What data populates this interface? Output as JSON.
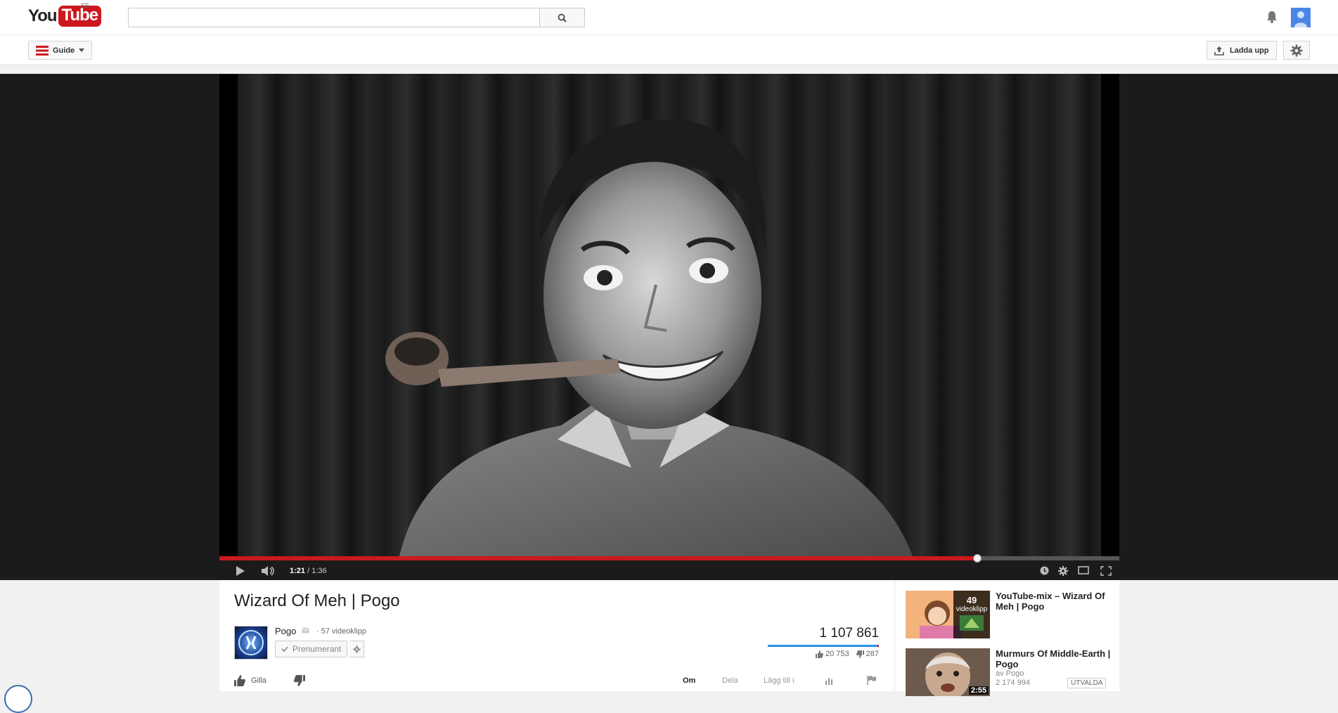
{
  "header": {
    "logo_you": "You",
    "logo_tube": "Tube",
    "country": "SE",
    "search_value": "",
    "search_placeholder": ""
  },
  "subbar": {
    "guide_label": "Guide",
    "upload_label": "Ladda upp"
  },
  "player": {
    "time_current": "1:21",
    "time_total": "/ 1:36",
    "progress": 0.842
  },
  "video": {
    "title": "Wizard Of Meh | Pogo",
    "channel": "Pogo",
    "channel_count": "· 57 videoklipp",
    "subscribe_label": "Prenumerant",
    "views": "1 107 861",
    "likes": "20 753",
    "dislikes": "287",
    "like_ratio": 0.986
  },
  "actions": {
    "like_label": "Gilla",
    "tabs": [
      "Om",
      "Dela",
      "Lägg till i"
    ]
  },
  "sidebar": {
    "items": [
      {
        "title": "YouTube-mix – Wizard Of Meh | Pogo",
        "overlay_count": "49",
        "overlay_label": "videoklipp"
      },
      {
        "title": "Murmurs Of Middle-Earth | Pogo",
        "author": "av Pogo",
        "views": "2 174 994",
        "badge": "UTVALDA",
        "duration": "2:55"
      }
    ]
  },
  "colors": {
    "brand_red": "#cc181e",
    "like_blue": "#2793e6"
  }
}
